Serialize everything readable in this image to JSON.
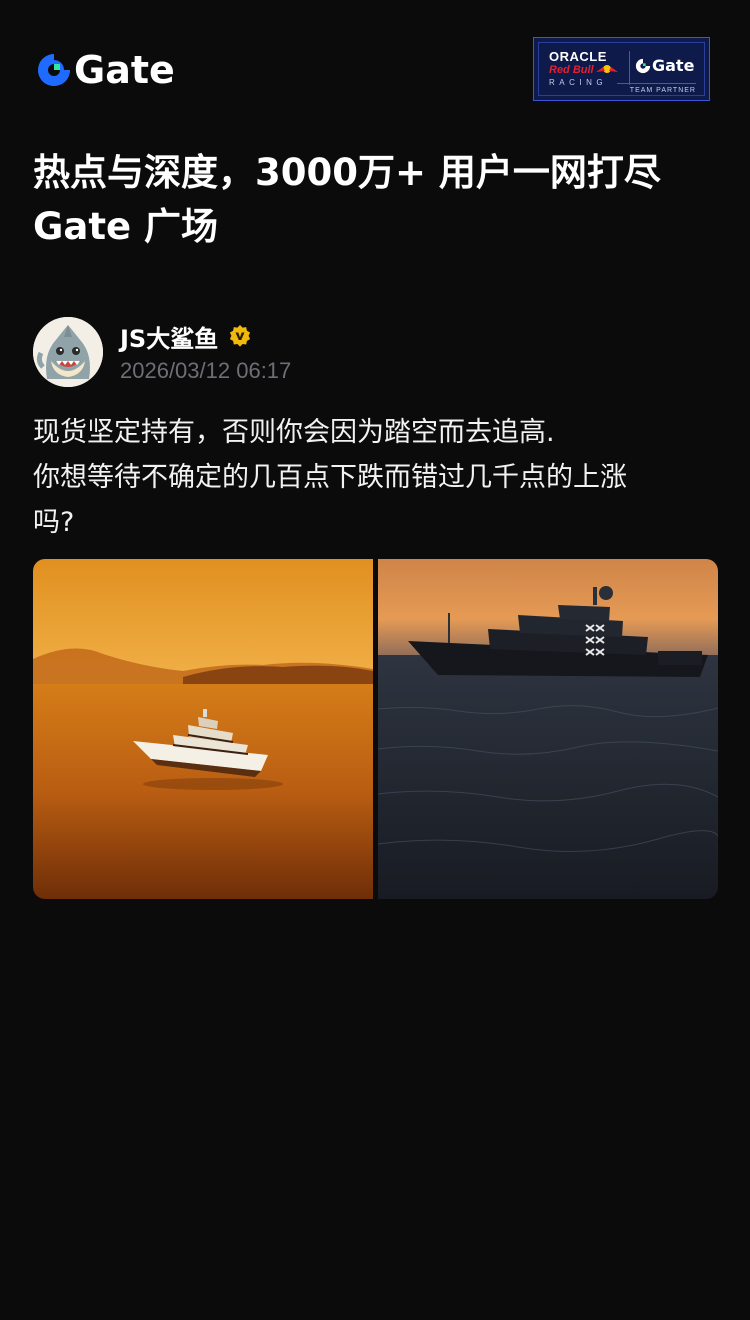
{
  "header": {
    "brand_name": "Gate",
    "brand_color": "#1f6bff",
    "partner_badge": {
      "oracle": "ORACLE",
      "redbull": "Red Bull",
      "racing": "RACING",
      "gate": "Gate",
      "partner": "TEAM PARTNER"
    }
  },
  "headline": {
    "line1": "热点与深度，3000万+ 用户一网打尽",
    "line2": "Gate 广场"
  },
  "post": {
    "author": {
      "name": "JS大鲨鱼",
      "verified_icon": "verified-v-icon",
      "verified_color": "#f0b90b",
      "avatar_icon": "shark-avatar"
    },
    "time": "2026/03/12 06:17",
    "text_lines": [
      "现货坚定持有，否则你会因为踏空而去追高.",
      "你想等待不确定的几百点下跌而错过几千点的上涨",
      "吗?"
    ],
    "images": [
      {
        "subject": "yacht-at-sunset-orange-sea"
      },
      {
        "subject": "yacht-at-dusk-dark-water"
      }
    ]
  }
}
